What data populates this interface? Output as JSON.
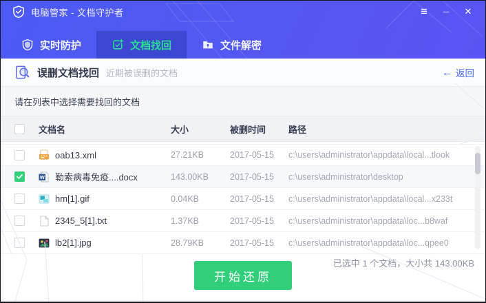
{
  "window": {
    "title": "电脑管家 - 文档守护者",
    "controls": {
      "menu": "≡",
      "minimize": "─",
      "close": "✕"
    }
  },
  "tabs": [
    {
      "label": "实时防护",
      "icon": "shield-icon",
      "active": false
    },
    {
      "label": "文档找回",
      "icon": "doc-restore-icon",
      "active": true
    },
    {
      "label": "文件解密",
      "icon": "folder-lock-icon",
      "active": false
    }
  ],
  "section": {
    "title": "误删文档找回",
    "subtitle": "近期被误删的文档",
    "back_arrow": "←",
    "back_label": "返回"
  },
  "instruction": "请在列表中选择需要找回的文档",
  "table": {
    "headers": {
      "name": "文档名",
      "size": "大小",
      "deleted_at": "被删时间",
      "path": "路径"
    },
    "rows": [
      {
        "name": "oab13.xml",
        "size": "27.21KB",
        "deleted_at": "2017-05-15",
        "path": "c:\\users\\administrator\\appdata\\local...tlook",
        "file_type": "xml",
        "checked": false
      },
      {
        "name": "勒索病毒免疫....docx",
        "size": "143.00KB",
        "deleted_at": "2017-05-15",
        "path": "c:\\users\\administrator\\desktop",
        "file_type": "docx",
        "checked": true
      },
      {
        "name": "hm[1].gif",
        "size": "0.04KB",
        "deleted_at": "2017-05-15",
        "path": "c:\\users\\administrator\\appdata\\local...x233t",
        "file_type": "gif",
        "checked": false
      },
      {
        "name": "2345_5[1].txt",
        "size": "1.37KB",
        "deleted_at": "2017-05-15",
        "path": "c:\\users\\administrator\\appdata\\loc...b8waf",
        "file_type": "txt",
        "checked": false
      },
      {
        "name": "lb2[1].jpg",
        "size": "28.79KB",
        "deleted_at": "2017-05-15",
        "path": "c:\\users\\administrator\\appdata\\loc...qpee0",
        "file_type": "jpg",
        "checked": false
      }
    ]
  },
  "footer": {
    "summary": "已选中 1 个文档，大小共 143.00KB",
    "restore_button": "开始还原"
  },
  "colors": {
    "header_blue": "#4f5af2",
    "active_tab_bg": "#3c48d2",
    "accent_green": "#28df8e",
    "button_green": "#32cf7a",
    "link_blue": "#4d6bf3"
  }
}
